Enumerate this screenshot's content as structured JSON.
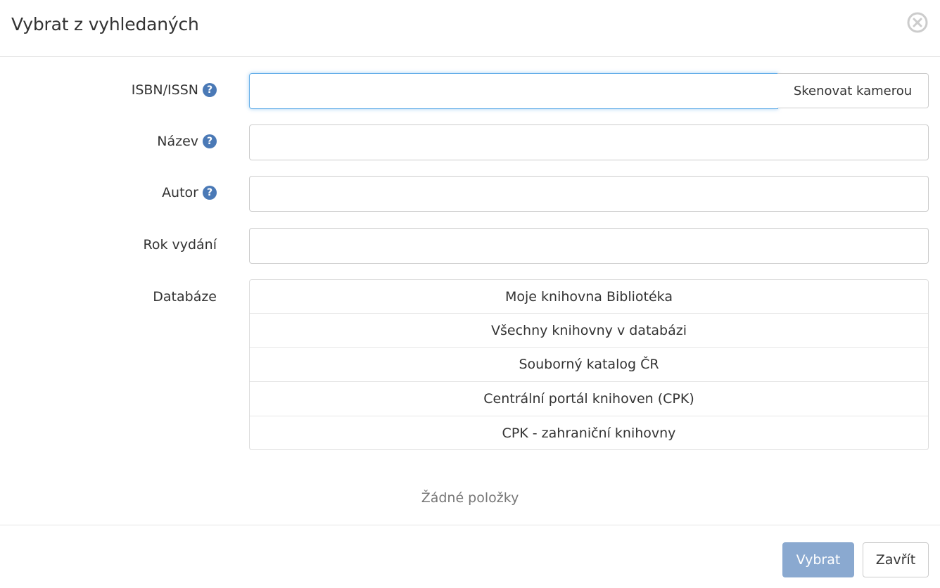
{
  "dialog": {
    "title": "Vybrat z vyhledaných",
    "close_icon": "close-circle-icon"
  },
  "form": {
    "isbn": {
      "label": "ISBN/ISSN",
      "help_icon": "question-circle-icon",
      "help_glyph": "?",
      "value": "",
      "scan_button": "Skenovat kamerou"
    },
    "title": {
      "label": "Název",
      "help_icon": "question-circle-icon",
      "help_glyph": "?",
      "value": ""
    },
    "author": {
      "label": "Autor",
      "help_icon": "question-circle-icon",
      "help_glyph": "?",
      "value": ""
    },
    "year": {
      "label": "Rok vydání",
      "value": ""
    },
    "databases": {
      "label": "Databáze",
      "items": [
        "Moje knihovna Bibliotéka",
        "Všechny knihovny v databázi",
        "Souborný katalog ČR",
        "Centrální portál knihoven (CPK)",
        "CPK - zahraniční knihovny"
      ]
    }
  },
  "results": {
    "empty_text": "Žádné položky"
  },
  "footer": {
    "select_label": "Vybrat",
    "close_label": "Zavřít"
  },
  "colors": {
    "accent": "#4a79b6",
    "primary_button": "#8aa9d0",
    "focus_border": "#66afe9"
  }
}
